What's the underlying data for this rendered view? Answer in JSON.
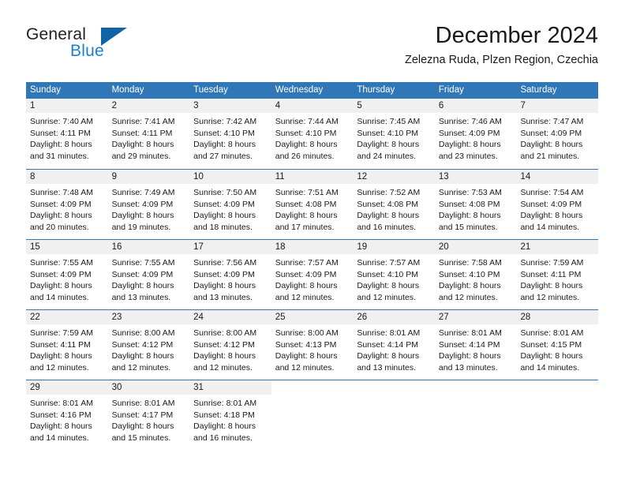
{
  "brand": {
    "name_top": "General",
    "name_bottom": "Blue",
    "accent_color": "#1163a8",
    "blue_text_color": "#1b7fd4"
  },
  "header": {
    "month_title": "December 2024",
    "location": "Zelezna Ruda, Plzen Region, Czechia"
  },
  "theme": {
    "header_blue": "#3077b8",
    "daynum_band": "#f0f0f0"
  },
  "weekdays": [
    "Sunday",
    "Monday",
    "Tuesday",
    "Wednesday",
    "Thursday",
    "Friday",
    "Saturday"
  ],
  "weeks": [
    [
      {
        "day": "1",
        "sunrise": "Sunrise: 7:40 AM",
        "sunset": "Sunset: 4:11 PM",
        "daylight1": "Daylight: 8 hours",
        "daylight2": "and 31 minutes."
      },
      {
        "day": "2",
        "sunrise": "Sunrise: 7:41 AM",
        "sunset": "Sunset: 4:11 PM",
        "daylight1": "Daylight: 8 hours",
        "daylight2": "and 29 minutes."
      },
      {
        "day": "3",
        "sunrise": "Sunrise: 7:42 AM",
        "sunset": "Sunset: 4:10 PM",
        "daylight1": "Daylight: 8 hours",
        "daylight2": "and 27 minutes."
      },
      {
        "day": "4",
        "sunrise": "Sunrise: 7:44 AM",
        "sunset": "Sunset: 4:10 PM",
        "daylight1": "Daylight: 8 hours",
        "daylight2": "and 26 minutes."
      },
      {
        "day": "5",
        "sunrise": "Sunrise: 7:45 AM",
        "sunset": "Sunset: 4:10 PM",
        "daylight1": "Daylight: 8 hours",
        "daylight2": "and 24 minutes."
      },
      {
        "day": "6",
        "sunrise": "Sunrise: 7:46 AM",
        "sunset": "Sunset: 4:09 PM",
        "daylight1": "Daylight: 8 hours",
        "daylight2": "and 23 minutes."
      },
      {
        "day": "7",
        "sunrise": "Sunrise: 7:47 AM",
        "sunset": "Sunset: 4:09 PM",
        "daylight1": "Daylight: 8 hours",
        "daylight2": "and 21 minutes."
      }
    ],
    [
      {
        "day": "8",
        "sunrise": "Sunrise: 7:48 AM",
        "sunset": "Sunset: 4:09 PM",
        "daylight1": "Daylight: 8 hours",
        "daylight2": "and 20 minutes."
      },
      {
        "day": "9",
        "sunrise": "Sunrise: 7:49 AM",
        "sunset": "Sunset: 4:09 PM",
        "daylight1": "Daylight: 8 hours",
        "daylight2": "and 19 minutes."
      },
      {
        "day": "10",
        "sunrise": "Sunrise: 7:50 AM",
        "sunset": "Sunset: 4:09 PM",
        "daylight1": "Daylight: 8 hours",
        "daylight2": "and 18 minutes."
      },
      {
        "day": "11",
        "sunrise": "Sunrise: 7:51 AM",
        "sunset": "Sunset: 4:08 PM",
        "daylight1": "Daylight: 8 hours",
        "daylight2": "and 17 minutes."
      },
      {
        "day": "12",
        "sunrise": "Sunrise: 7:52 AM",
        "sunset": "Sunset: 4:08 PM",
        "daylight1": "Daylight: 8 hours",
        "daylight2": "and 16 minutes."
      },
      {
        "day": "13",
        "sunrise": "Sunrise: 7:53 AM",
        "sunset": "Sunset: 4:08 PM",
        "daylight1": "Daylight: 8 hours",
        "daylight2": "and 15 minutes."
      },
      {
        "day": "14",
        "sunrise": "Sunrise: 7:54 AM",
        "sunset": "Sunset: 4:09 PM",
        "daylight1": "Daylight: 8 hours",
        "daylight2": "and 14 minutes."
      }
    ],
    [
      {
        "day": "15",
        "sunrise": "Sunrise: 7:55 AM",
        "sunset": "Sunset: 4:09 PM",
        "daylight1": "Daylight: 8 hours",
        "daylight2": "and 14 minutes."
      },
      {
        "day": "16",
        "sunrise": "Sunrise: 7:55 AM",
        "sunset": "Sunset: 4:09 PM",
        "daylight1": "Daylight: 8 hours",
        "daylight2": "and 13 minutes."
      },
      {
        "day": "17",
        "sunrise": "Sunrise: 7:56 AM",
        "sunset": "Sunset: 4:09 PM",
        "daylight1": "Daylight: 8 hours",
        "daylight2": "and 13 minutes."
      },
      {
        "day": "18",
        "sunrise": "Sunrise: 7:57 AM",
        "sunset": "Sunset: 4:09 PM",
        "daylight1": "Daylight: 8 hours",
        "daylight2": "and 12 minutes."
      },
      {
        "day": "19",
        "sunrise": "Sunrise: 7:57 AM",
        "sunset": "Sunset: 4:10 PM",
        "daylight1": "Daylight: 8 hours",
        "daylight2": "and 12 minutes."
      },
      {
        "day": "20",
        "sunrise": "Sunrise: 7:58 AM",
        "sunset": "Sunset: 4:10 PM",
        "daylight1": "Daylight: 8 hours",
        "daylight2": "and 12 minutes."
      },
      {
        "day": "21",
        "sunrise": "Sunrise: 7:59 AM",
        "sunset": "Sunset: 4:11 PM",
        "daylight1": "Daylight: 8 hours",
        "daylight2": "and 12 minutes."
      }
    ],
    [
      {
        "day": "22",
        "sunrise": "Sunrise: 7:59 AM",
        "sunset": "Sunset: 4:11 PM",
        "daylight1": "Daylight: 8 hours",
        "daylight2": "and 12 minutes."
      },
      {
        "day": "23",
        "sunrise": "Sunrise: 8:00 AM",
        "sunset": "Sunset: 4:12 PM",
        "daylight1": "Daylight: 8 hours",
        "daylight2": "and 12 minutes."
      },
      {
        "day": "24",
        "sunrise": "Sunrise: 8:00 AM",
        "sunset": "Sunset: 4:12 PM",
        "daylight1": "Daylight: 8 hours",
        "daylight2": "and 12 minutes."
      },
      {
        "day": "25",
        "sunrise": "Sunrise: 8:00 AM",
        "sunset": "Sunset: 4:13 PM",
        "daylight1": "Daylight: 8 hours",
        "daylight2": "and 12 minutes."
      },
      {
        "day": "26",
        "sunrise": "Sunrise: 8:01 AM",
        "sunset": "Sunset: 4:14 PM",
        "daylight1": "Daylight: 8 hours",
        "daylight2": "and 13 minutes."
      },
      {
        "day": "27",
        "sunrise": "Sunrise: 8:01 AM",
        "sunset": "Sunset: 4:14 PM",
        "daylight1": "Daylight: 8 hours",
        "daylight2": "and 13 minutes."
      },
      {
        "day": "28",
        "sunrise": "Sunrise: 8:01 AM",
        "sunset": "Sunset: 4:15 PM",
        "daylight1": "Daylight: 8 hours",
        "daylight2": "and 14 minutes."
      }
    ],
    [
      {
        "day": "29",
        "sunrise": "Sunrise: 8:01 AM",
        "sunset": "Sunset: 4:16 PM",
        "daylight1": "Daylight: 8 hours",
        "daylight2": "and 14 minutes."
      },
      {
        "day": "30",
        "sunrise": "Sunrise: 8:01 AM",
        "sunset": "Sunset: 4:17 PM",
        "daylight1": "Daylight: 8 hours",
        "daylight2": "and 15 minutes."
      },
      {
        "day": "31",
        "sunrise": "Sunrise: 8:01 AM",
        "sunset": "Sunset: 4:18 PM",
        "daylight1": "Daylight: 8 hours",
        "daylight2": "and 16 minutes."
      },
      {
        "day": "",
        "sunrise": "",
        "sunset": "",
        "daylight1": "",
        "daylight2": ""
      },
      {
        "day": "",
        "sunrise": "",
        "sunset": "",
        "daylight1": "",
        "daylight2": ""
      },
      {
        "day": "",
        "sunrise": "",
        "sunset": "",
        "daylight1": "",
        "daylight2": ""
      },
      {
        "day": "",
        "sunrise": "",
        "sunset": "",
        "daylight1": "",
        "daylight2": ""
      }
    ]
  ]
}
